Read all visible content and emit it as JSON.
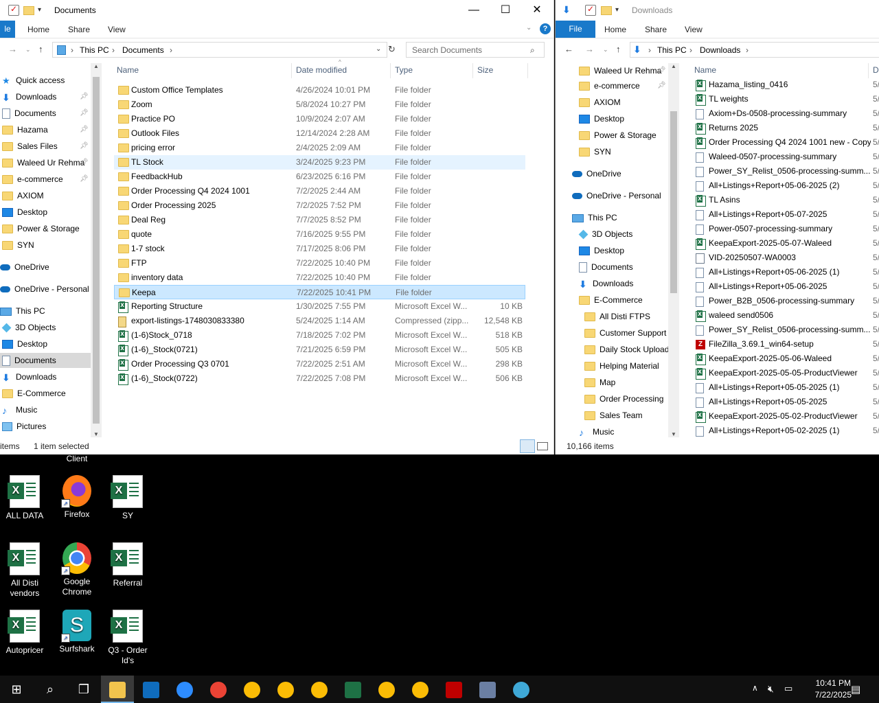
{
  "left": {
    "title": "Documents",
    "ribbon": {
      "file": "le",
      "tabs": [
        "Home",
        "Share",
        "View"
      ]
    },
    "breadcrumb": [
      "This PC",
      "Documents"
    ],
    "search_placeholder": "Search Documents",
    "nav": [
      {
        "label": "Quick access",
        "icon": "star-icon"
      },
      {
        "label": "Downloads",
        "icon": "downloads-icon",
        "pinned": true
      },
      {
        "label": "Documents",
        "icon": "documents-icon",
        "pinned": true
      },
      {
        "label": "Hazama",
        "icon": "folder-icon",
        "pinned": true
      },
      {
        "label": "Sales Files",
        "icon": "folder-icon",
        "pinned": true
      },
      {
        "label": "Waleed Ur Rehma",
        "icon": "folder-icon",
        "pinned": true
      },
      {
        "label": "e-commerce",
        "icon": "folder-icon",
        "pinned": true
      },
      {
        "label": "AXIOM",
        "icon": "folder-icon"
      },
      {
        "label": "Desktop",
        "icon": "desktop-icon"
      },
      {
        "label": "Power & Storage",
        "icon": "folder-icon"
      },
      {
        "label": "SYN",
        "icon": "folder-icon"
      },
      {
        "label": "OneDrive",
        "icon": "onedrive-icon"
      },
      {
        "label": "OneDrive - Personal",
        "icon": "onedrive-icon"
      },
      {
        "label": "This PC",
        "icon": "this-pc-icon"
      },
      {
        "label": "3D Objects",
        "icon": "3d-objects-icon"
      },
      {
        "label": "Desktop",
        "icon": "desktop-icon"
      },
      {
        "label": "Documents",
        "icon": "documents-icon",
        "selected": true
      },
      {
        "label": "Downloads",
        "icon": "downloads-icon"
      },
      {
        "label": "E-Commerce",
        "icon": "folder-icon"
      },
      {
        "label": "Music",
        "icon": "music-icon"
      },
      {
        "label": "Pictures",
        "icon": "pictures-icon"
      }
    ],
    "columns": {
      "name": "Name",
      "date": "Date modified",
      "type": "Type",
      "size": "Size"
    },
    "files": [
      {
        "name": "Custom Office Templates",
        "date": "4/26/2024 10:01 PM",
        "type": "File folder",
        "size": "",
        "icon": "folder"
      },
      {
        "name": "Zoom",
        "date": "5/8/2024 10:27 PM",
        "type": "File folder",
        "size": "",
        "icon": "folder"
      },
      {
        "name": "Practice PO",
        "date": "10/9/2024 2:07 AM",
        "type": "File folder",
        "size": "",
        "icon": "folder"
      },
      {
        "name": "Outlook Files",
        "date": "12/14/2024 2:28 AM",
        "type": "File folder",
        "size": "",
        "icon": "folder"
      },
      {
        "name": "pricing error",
        "date": "2/4/2025 2:09 AM",
        "type": "File folder",
        "size": "",
        "icon": "folder"
      },
      {
        "name": "TL Stock",
        "date": "3/24/2025 9:23 PM",
        "type": "File folder",
        "size": "",
        "icon": "folder",
        "hover": true
      },
      {
        "name": "FeedbackHub",
        "date": "6/23/2025 6:16 PM",
        "type": "File folder",
        "size": "",
        "icon": "folder"
      },
      {
        "name": "Order Processing Q4 2024 1001",
        "date": "7/2/2025 2:44 AM",
        "type": "File folder",
        "size": "",
        "icon": "folder"
      },
      {
        "name": "Order Processing 2025",
        "date": "7/2/2025 7:52 PM",
        "type": "File folder",
        "size": "",
        "icon": "folder"
      },
      {
        "name": "Deal Reg",
        "date": "7/7/2025 8:52 PM",
        "type": "File folder",
        "size": "",
        "icon": "folder"
      },
      {
        "name": "quote",
        "date": "7/16/2025 9:55 PM",
        "type": "File folder",
        "size": "",
        "icon": "folder"
      },
      {
        "name": "1-7 stock",
        "date": "7/17/2025 8:06 PM",
        "type": "File folder",
        "size": "",
        "icon": "folder"
      },
      {
        "name": "FTP",
        "date": "7/22/2025 10:40 PM",
        "type": "File folder",
        "size": "",
        "icon": "folder"
      },
      {
        "name": "inventory data",
        "date": "7/22/2025 10:40 PM",
        "type": "File folder",
        "size": "",
        "icon": "folder"
      },
      {
        "name": "Keepa",
        "date": "7/22/2025 10:41 PM",
        "type": "File folder",
        "size": "",
        "icon": "folder",
        "selected": true
      },
      {
        "name": "Reporting Structure",
        "date": "1/30/2025 7:55 PM",
        "type": "Microsoft Excel W...",
        "size": "10 KB",
        "icon": "xls"
      },
      {
        "name": "export-listings-1748030833380",
        "date": "5/24/2025 1:14 AM",
        "type": "Compressed (zipp...",
        "size": "12,548 KB",
        "icon": "zip"
      },
      {
        "name": "(1-6)Stock_0718",
        "date": "7/18/2025 7:02 PM",
        "type": "Microsoft Excel W...",
        "size": "518 KB",
        "icon": "xls"
      },
      {
        "name": "(1-6)_Stock(0721)",
        "date": "7/21/2025 6:59 PM",
        "type": "Microsoft Excel W...",
        "size": "505 KB",
        "icon": "xls"
      },
      {
        "name": "Order Processing Q3 0701",
        "date": "7/22/2025 2:51 AM",
        "type": "Microsoft Excel W...",
        "size": "298 KB",
        "icon": "xls"
      },
      {
        "name": "(1-6)_Stock(0722)",
        "date": "7/22/2025 7:08 PM",
        "type": "Microsoft Excel W...",
        "size": "506 KB",
        "icon": "xls"
      }
    ],
    "status": {
      "items": "items",
      "selected": "1 item selected"
    }
  },
  "right": {
    "title": "Downloads",
    "ribbon": {
      "file": "File",
      "tabs": [
        "Home",
        "Share",
        "View"
      ]
    },
    "breadcrumb": [
      "This PC",
      "Downloads"
    ],
    "nav": [
      {
        "label": "Waleed Ur Rehma",
        "icon": "folder-icon",
        "pinned": true,
        "indent": 0
      },
      {
        "label": "e-commerce",
        "icon": "folder-icon",
        "pinned": true,
        "indent": 0
      },
      {
        "label": "AXIOM",
        "icon": "folder-icon",
        "indent": 0
      },
      {
        "label": "Desktop",
        "icon": "desktop-icon",
        "indent": 0
      },
      {
        "label": "Power & Storage",
        "icon": "folder-icon",
        "indent": 0
      },
      {
        "label": "SYN",
        "icon": "folder-icon",
        "indent": 0
      },
      {
        "label": "OneDrive",
        "icon": "onedrive-icon",
        "indent": -1,
        "gap": true
      },
      {
        "label": "OneDrive - Personal",
        "icon": "onedrive-icon",
        "indent": -1,
        "gap": true
      },
      {
        "label": "This PC",
        "icon": "this-pc-icon",
        "indent": -1,
        "gap": true
      },
      {
        "label": "3D Objects",
        "icon": "3d-objects-icon",
        "indent": 0
      },
      {
        "label": "Desktop",
        "icon": "desktop-icon",
        "indent": 0
      },
      {
        "label": "Documents",
        "icon": "documents-icon",
        "indent": 0
      },
      {
        "label": "Downloads",
        "icon": "downloads-icon",
        "indent": 0
      },
      {
        "label": "E-Commerce",
        "icon": "folder-icon",
        "indent": 0
      },
      {
        "label": "All Disti FTPS",
        "icon": "folder-icon",
        "indent": 1
      },
      {
        "label": "Customer Support",
        "icon": "folder-icon",
        "indent": 1
      },
      {
        "label": "Daily Stock Uploads",
        "icon": "folder-icon",
        "indent": 1
      },
      {
        "label": "Helping Material",
        "icon": "folder-icon",
        "indent": 1
      },
      {
        "label": "Map",
        "icon": "folder-icon",
        "indent": 1
      },
      {
        "label": "Order Processing",
        "icon": "folder-icon",
        "indent": 1
      },
      {
        "label": "Sales Team",
        "icon": "folder-icon",
        "indent": 1
      },
      {
        "label": "Music",
        "icon": "music-icon",
        "indent": 0
      }
    ],
    "columns": {
      "name": "Name",
      "date": "D"
    },
    "files": [
      {
        "name": "Hazama_listing_0416",
        "icon": "xls"
      },
      {
        "name": "TL weights",
        "icon": "xls"
      },
      {
        "name": "Axiom+Ds-0508-processing-summary",
        "icon": "doc"
      },
      {
        "name": "Returns 2025",
        "icon": "xls"
      },
      {
        "name": "Order Processing Q4 2024 1001 new - Copy",
        "icon": "xls"
      },
      {
        "name": "Waleed-0507-processing-summary",
        "icon": "doc"
      },
      {
        "name": "Power_SY_Relist_0506-processing-summ...",
        "icon": "doc"
      },
      {
        "name": "All+Listings+Report+05-06-2025 (2)",
        "icon": "doc"
      },
      {
        "name": "TL Asins",
        "icon": "xls"
      },
      {
        "name": "All+Listings+Report+05-07-2025",
        "icon": "doc"
      },
      {
        "name": "Power-0507-processing-summary",
        "icon": "doc"
      },
      {
        "name": "KeepaExport-2025-05-07-Waleed",
        "icon": "xls"
      },
      {
        "name": "VID-20250507-WA0003",
        "icon": "vid"
      },
      {
        "name": "All+Listings+Report+05-06-2025 (1)",
        "icon": "doc"
      },
      {
        "name": "All+Listings+Report+05-06-2025",
        "icon": "doc"
      },
      {
        "name": "Power_B2B_0506-processing-summary",
        "icon": "doc"
      },
      {
        "name": "waleed send0506",
        "icon": "xls"
      },
      {
        "name": "Power_SY_Relist_0506-processing-summ...",
        "icon": "doc"
      },
      {
        "name": "FileZilla_3.69.1_win64-setup",
        "icon": "fz"
      },
      {
        "name": "KeepaExport-2025-05-06-Waleed",
        "icon": "xls"
      },
      {
        "name": "KeepaExport-2025-05-05-ProductViewer",
        "icon": "xls"
      },
      {
        "name": "All+Listings+Report+05-05-2025 (1)",
        "icon": "doc"
      },
      {
        "name": "All+Listings+Report+05-05-2025",
        "icon": "doc"
      },
      {
        "name": "KeepaExport-2025-05-02-ProductViewer",
        "icon": "xls"
      },
      {
        "name": "All+Listings+Report+05-02-2025 (1)",
        "icon": "doc"
      }
    ],
    "date_prefix": "5/",
    "status": {
      "items": "10,166 items"
    }
  },
  "desktop": {
    "partial_label": "Client",
    "icons": [
      {
        "label": "ALL DATA",
        "type": "xls"
      },
      {
        "label": "Firefox",
        "type": "firefox"
      },
      {
        "label": "SY",
        "type": "xls"
      },
      {
        "label": "All Disti vendors",
        "type": "xls"
      },
      {
        "label": "Google Chrome",
        "type": "chrome"
      },
      {
        "label": "Referral",
        "type": "xls"
      },
      {
        "label": "Autopricer",
        "type": "xls"
      },
      {
        "label": "Surfshark",
        "type": "surfshark"
      },
      {
        "label": "Q3 - Order Id's",
        "type": "xls"
      }
    ]
  },
  "taskbar": {
    "apps": [
      "start-icon",
      "search-icon",
      "task-view-icon",
      "file-explorer-icon",
      "outlook-icon",
      "zoom-icon",
      "chrome-w-icon",
      "chrome-profile-icon",
      "chrome-profile-icon",
      "chrome-profile-icon",
      "excel-icon",
      "chrome-profile-icon",
      "chrome-profile-icon",
      "filezilla-icon",
      "calculator-icon",
      "app-icon"
    ],
    "time": "10:41 PM",
    "date": "7/22/2025"
  }
}
